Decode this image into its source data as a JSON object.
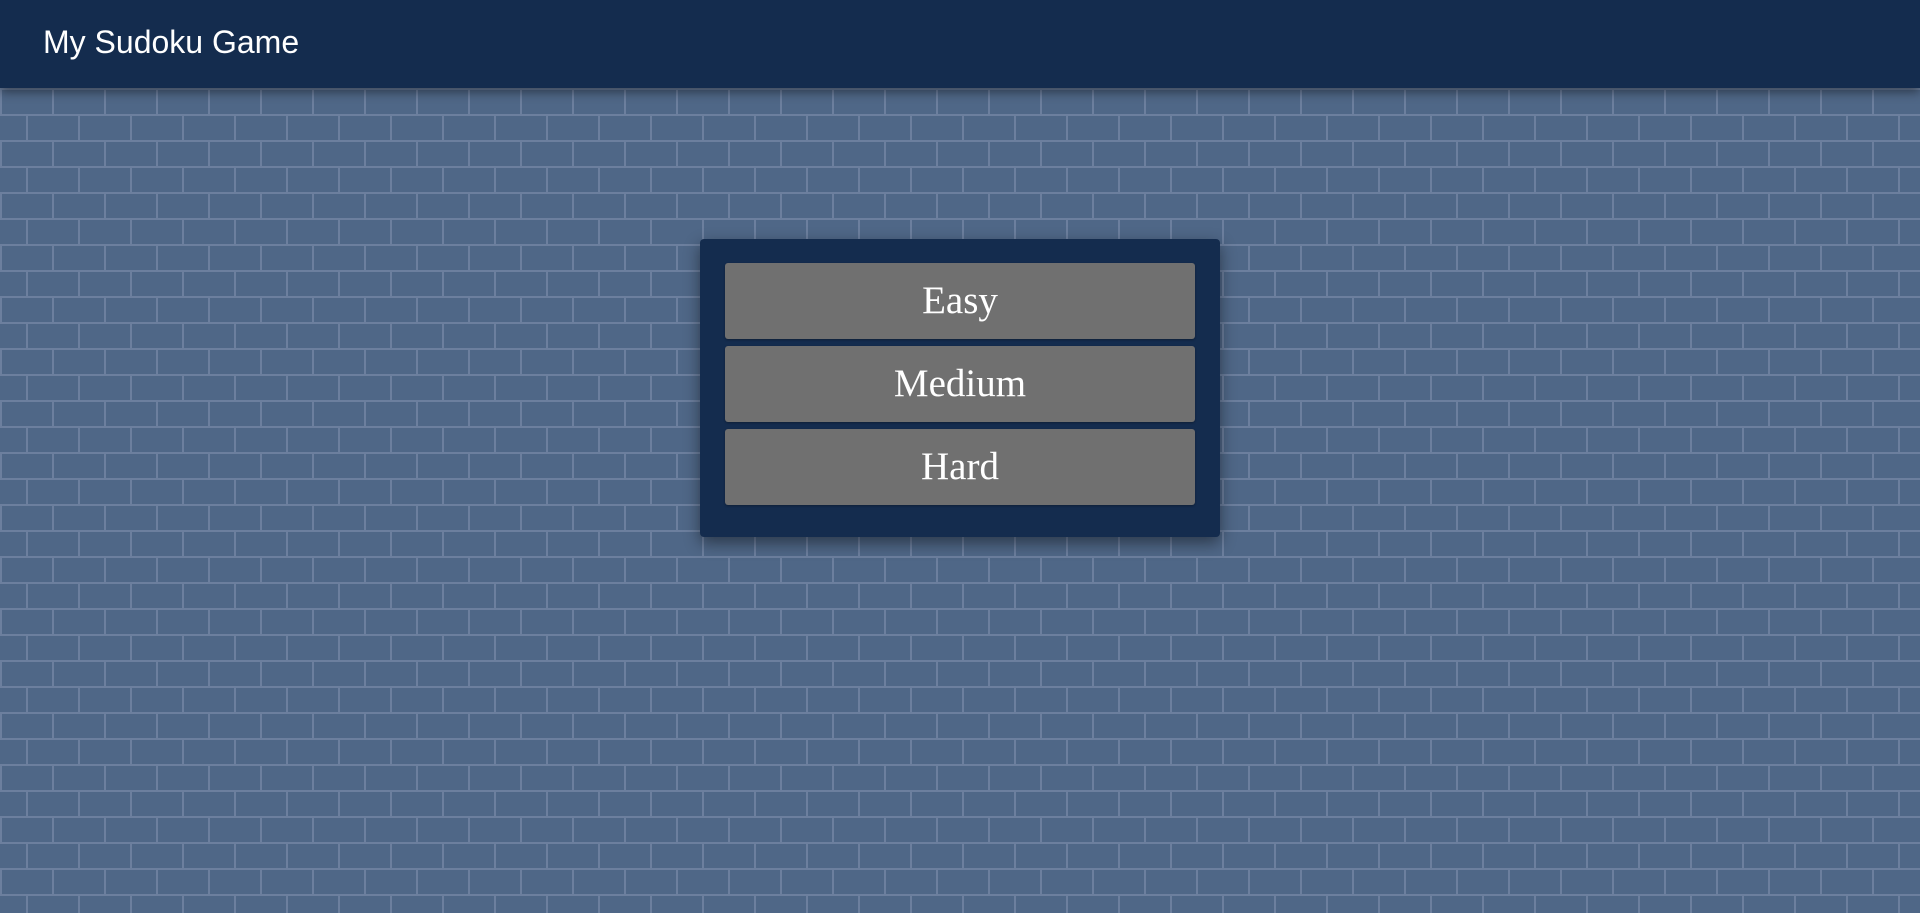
{
  "header": {
    "title": "My Sudoku Game"
  },
  "menu": {
    "buttons": [
      {
        "label": "Easy"
      },
      {
        "label": "Medium"
      },
      {
        "label": "Hard"
      }
    ]
  },
  "colors": {
    "header_bg": "#142c4e",
    "panel_bg": "#142c4e",
    "button_bg": "#707070",
    "wall_bg": "#4f6787",
    "mortar": "#6c7f9e",
    "text": "#ffffff"
  }
}
